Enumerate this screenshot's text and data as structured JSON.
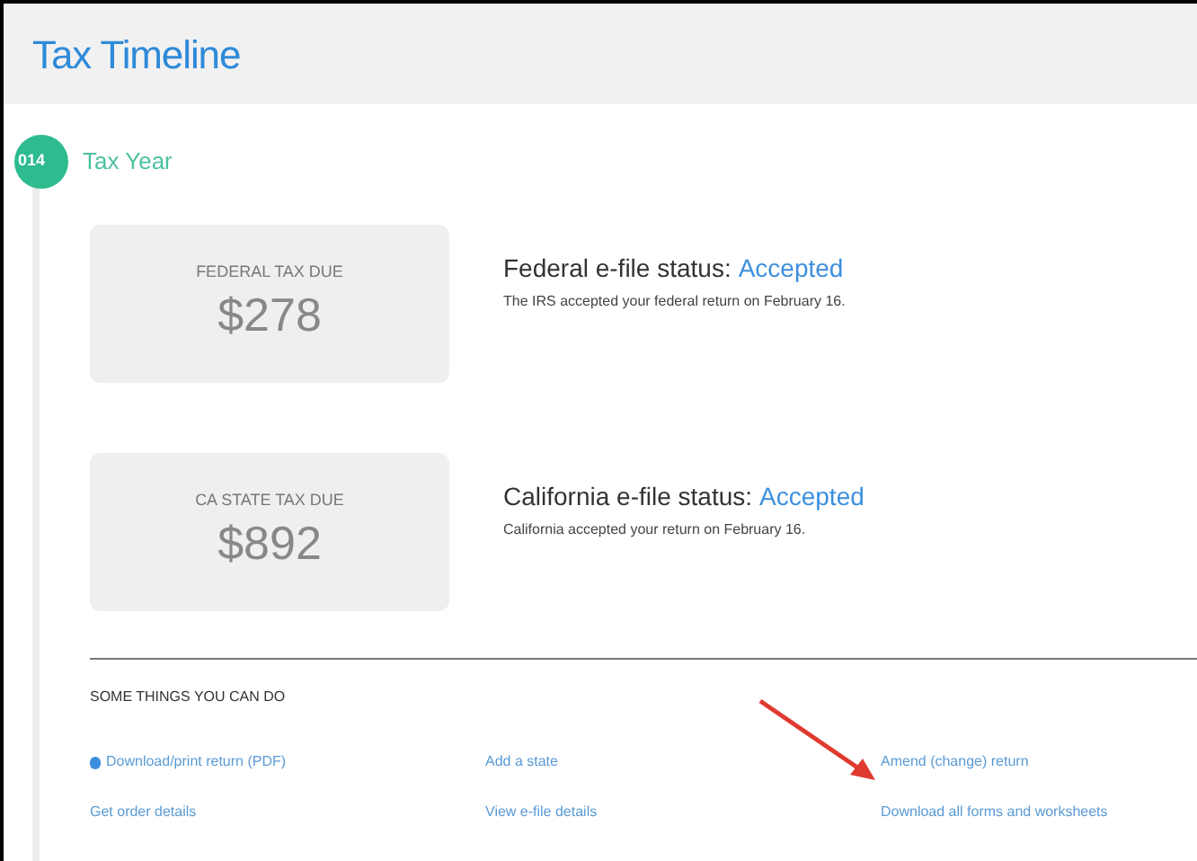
{
  "window": {
    "title": "Tax Timeline"
  },
  "year": {
    "badge": "014",
    "label": "Tax Year"
  },
  "returns": [
    {
      "due_label": "FEDERAL TAX DUE",
      "amount": "$278",
      "status_label": "Federal e-file status:",
      "status": "Accepted",
      "note": "The IRS accepted your federal return on February 16."
    },
    {
      "due_label": "CA STATE TAX DUE",
      "amount": "$892",
      "status_label": "California e-file status:",
      "status": "Accepted",
      "note": "California accepted your return on February 16."
    }
  ],
  "actions": {
    "heading": "SOME THINGS YOU CAN DO",
    "links": [
      {
        "label": "Download/print return (PDF)",
        "kind": "print"
      },
      {
        "label": "Add a state",
        "kind": "plain"
      },
      {
        "label": "Amend (change) return",
        "kind": "highlighted"
      },
      {
        "label": "Get order details",
        "kind": "plain"
      },
      {
        "label": "View e-file details",
        "kind": "plain"
      },
      {
        "label": "Download all forms and worksheets",
        "kind": "plain"
      }
    ]
  }
}
